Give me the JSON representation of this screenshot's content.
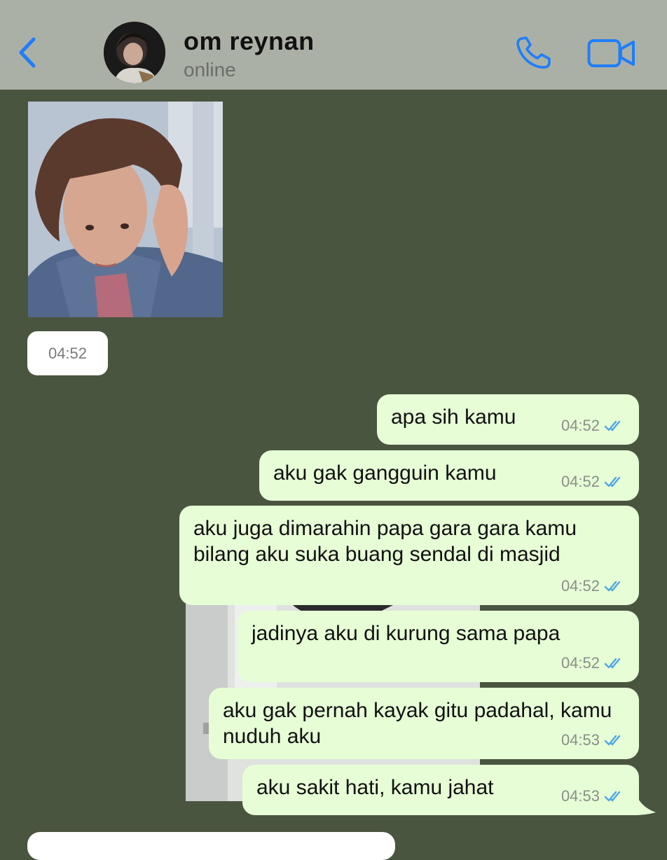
{
  "header": {
    "contact_name": "om reynan",
    "status": "online",
    "accent_color": "#1f7ef7",
    "background": "#abb0a6"
  },
  "chat": {
    "background": "#4a5540",
    "incoming": {
      "photo": "portrait-photo",
      "time": "04:52"
    },
    "messages": [
      {
        "text": "apa sih kamu",
        "time": "04:52",
        "status": "read"
      },
      {
        "text": "aku gak gangguin kamu",
        "time": "04:52",
        "status": "read"
      },
      {
        "text": "aku juga dimarahin papa gara gara kamu bilang aku suka buang sendal di masjid",
        "time": "04:52",
        "status": "read"
      },
      {
        "text": "jadinya aku di kurung sama papa",
        "time": "04:52",
        "status": "read"
      },
      {
        "text": "aku gak pernah kayak gitu padahal, kamu nuduh aku",
        "time": "04:53",
        "status": "read"
      },
      {
        "text": "aku sakit hati, kamu jahat",
        "time": "04:53",
        "status": "read"
      }
    ],
    "outgoing_bubble_color": "#e6fdd6",
    "read_tick_color": "#4fa6e8"
  }
}
